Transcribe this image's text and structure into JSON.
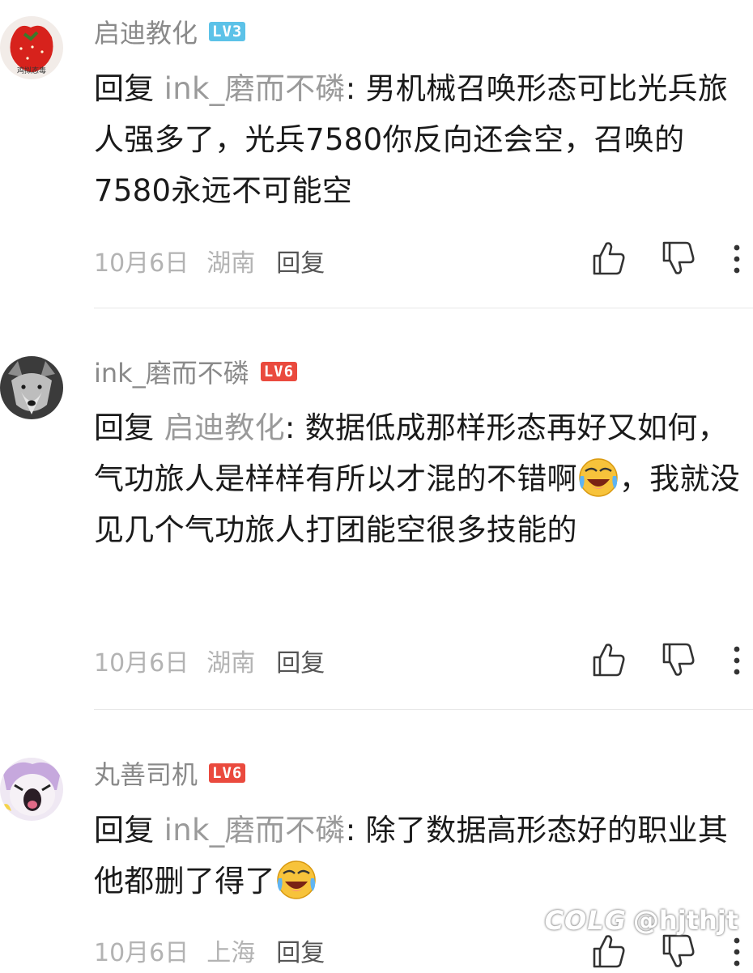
{
  "comments": [
    {
      "username": "启迪教化",
      "level": "LV3",
      "avatar_caption": "鸡拟态毒",
      "reply_prefix": "回复 ",
      "reply_target": "ink_磨而不磷",
      "text": ": 男机械召唤形态可比光兵旅人强多了，光兵7580你反向还会空，召唤的7580永远不可能空",
      "date": "10月6日",
      "location": "湖南",
      "reply_label": "回复"
    },
    {
      "username": "ink_磨而不磷",
      "level": "LV6",
      "reply_prefix": "回复 ",
      "reply_target": "启迪教化",
      "text_before_emoji": ": 数据低成那样形态再好又如何，气功旅人是样样有所以才混的不错啊",
      "text_after_emoji": "，我就没见几个气功旅人打团能空很多技能的",
      "date": "10月6日",
      "location": "湖南",
      "reply_label": "回复"
    },
    {
      "username": "丸善司机",
      "level": "LV6",
      "reply_prefix": "回复 ",
      "reply_target": "ink_磨而不磷",
      "text": ": 除了数据高形态好的职业其他都删了得了",
      "date": "10月6日",
      "location": "上海",
      "reply_label": "回复"
    }
  ],
  "icons": {
    "like": "thumbs-up-icon",
    "dislike": "thumbs-down-icon",
    "more": "more-vertical-icon",
    "emoji": "laughing-crying-emoji"
  },
  "watermark": {
    "brand": "COLG",
    "handle": "@hjthjt"
  },
  "colors": {
    "lv3": "#5cc2e8",
    "lv6": "#ea4a3e",
    "username": "#8a8a8a",
    "meta": "#b3b3b3"
  }
}
